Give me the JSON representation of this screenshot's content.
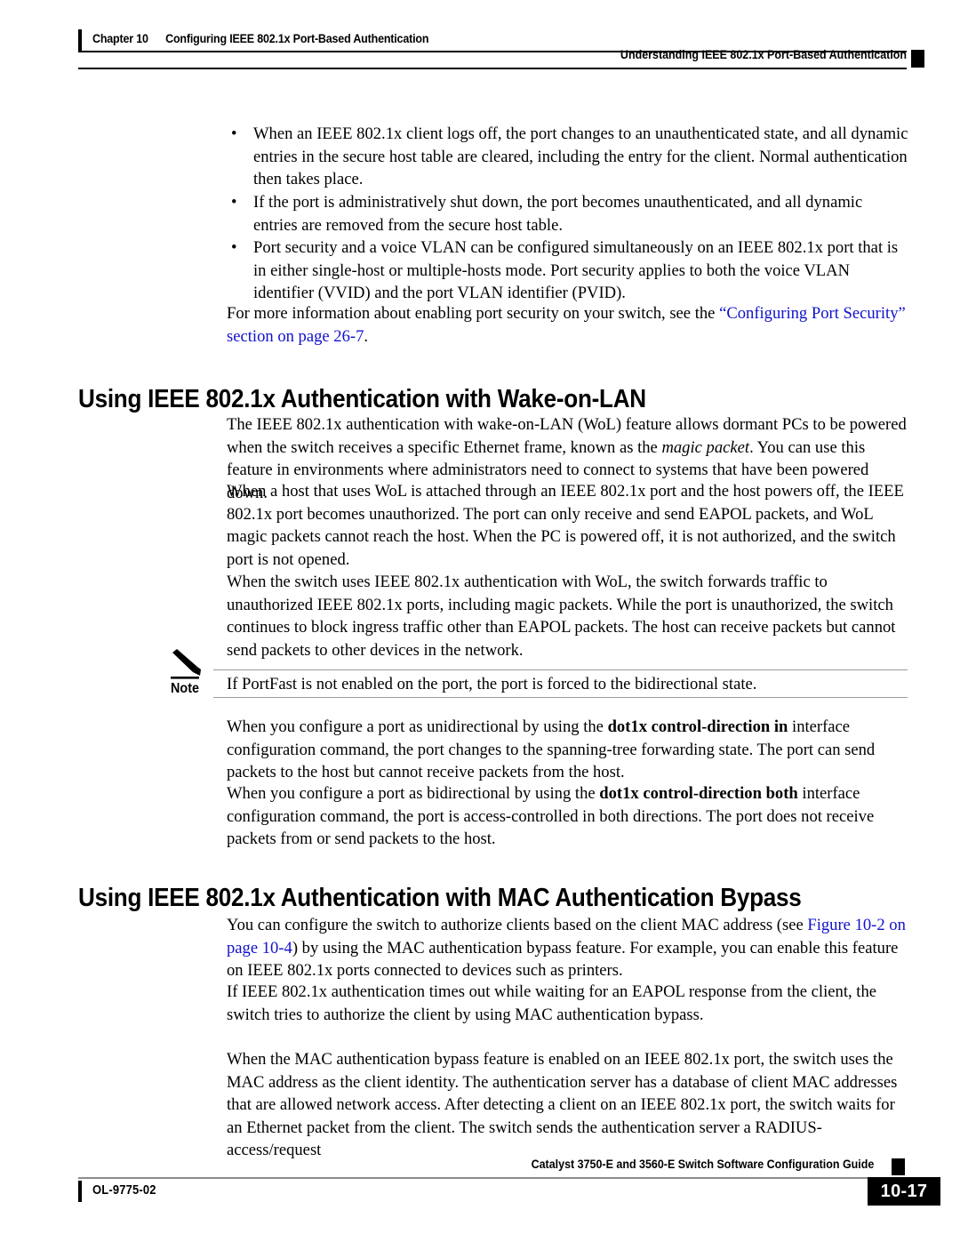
{
  "header": {
    "chapter_number": "Chapter 10",
    "chapter_title": "Configuring IEEE 802.1x Port-Based Authentication",
    "section_title": "Understanding IEEE 802.1x Port-Based Authentication"
  },
  "bullets": [
    {
      "marker": "•",
      "text": "When an IEEE 802.1x client logs off, the port changes to an unauthenticated state, and all dynamic entries in the secure host table are cleared, including the entry for the client. Normal authentication then takes place."
    },
    {
      "marker": "•",
      "text": "If the port is administratively shut down, the port becomes unauthenticated, and all dynamic entries are removed from the secure host table."
    },
    {
      "marker": "•",
      "text": "Port security and a voice VLAN can be configured simultaneously on an IEEE 802.1x port that is in either single-host or multiple-hosts mode. Port security applies to both the voice VLAN identifier (VVID) and the port VLAN identifier (PVID)."
    }
  ],
  "port_security_xref": {
    "lead_in": "For more information about enabling port security on your switch, see the ",
    "link_text": "“Configuring Port Security” section on page 26-7",
    "trailing": "."
  },
  "section_wol": {
    "heading": "Using IEEE 802.1x Authentication with Wake-on-LAN",
    "paragraphs": [
      {
        "part1": "The IEEE 802.1x authentication with wake-on-LAN (WoL) feature allows dormant PCs to be powered when the switch receives a specific Ethernet frame, known as the ",
        "italic": "magic packet",
        "part2": ". You can use this feature in environments where administrators need to connect to systems that have been powered down."
      },
      {
        "text": "When a host that uses WoL is attached through an IEEE 802.1x port and the host powers off, the IEEE 802.1x port becomes unauthorized. The port can only receive and send EAPOL packets, and WoL magic packets cannot reach the host. When the PC is powered off, it is not authorized, and the switch port is not opened."
      },
      {
        "text": "When the switch uses IEEE 802.1x authentication with WoL, the switch forwards traffic to unauthorized IEEE 802.1x ports, including magic packets. While the port is unauthorized, the switch continues to block ingress traffic other than EAPOL packets. The host can receive packets but cannot send packets to other devices in the network."
      }
    ],
    "note": {
      "label": "Note",
      "text": "If PortFast is not enabled on the port, the port is forced to the bidirectional state."
    },
    "after_note": [
      {
        "part1": "When you configure a port as unidirectional by using the ",
        "bold": "dot1x control-direction in",
        "part2": " interface configuration command, the port changes to the spanning-tree forwarding state. The port can send packets to the host but cannot receive packets from the host."
      },
      {
        "part1": "When you configure a port as bidirectional by using the ",
        "bold": "dot1x control-direction both",
        "part2": " interface configuration command, the port is access-controlled in both directions. The port does not receive packets from or send packets to the host."
      }
    ]
  },
  "section_mab": {
    "heading": "Using IEEE 802.1x Authentication with MAC Authentication Bypass",
    "paragraph1": {
      "part1": "You can configure the switch to authorize clients based on the client MAC address (see ",
      "link_text": "Figure 10-2 on page 10-4",
      "part2": ") by using the MAC authentication bypass feature. For example, you can enable this feature on IEEE 802.1x ports connected to devices such as printers."
    },
    "paragraph2": "If IEEE 802.1x authentication times out while waiting for an EAPOL response from the client, the switch tries to authorize the client by using MAC authentication bypass.",
    "paragraph3": "When the MAC authentication bypass feature is enabled on an IEEE 802.1x port, the switch uses the MAC address as the client identity. The authentication server has a database of client MAC addresses that are allowed network access. After detecting a client on an IEEE 802.1x port, the switch waits for an Ethernet packet from the client. The switch sends the authentication server a RADIUS-access/request"
  },
  "footer": {
    "doc_number": "OL-9775-02",
    "guide_title": "Catalyst 3750-E and 3560-E Switch Software Configuration Guide",
    "page_number": "10-17"
  },
  "colors": {
    "link": "#1111cc",
    "text": "#000000",
    "rule": "#9a9a9a"
  }
}
